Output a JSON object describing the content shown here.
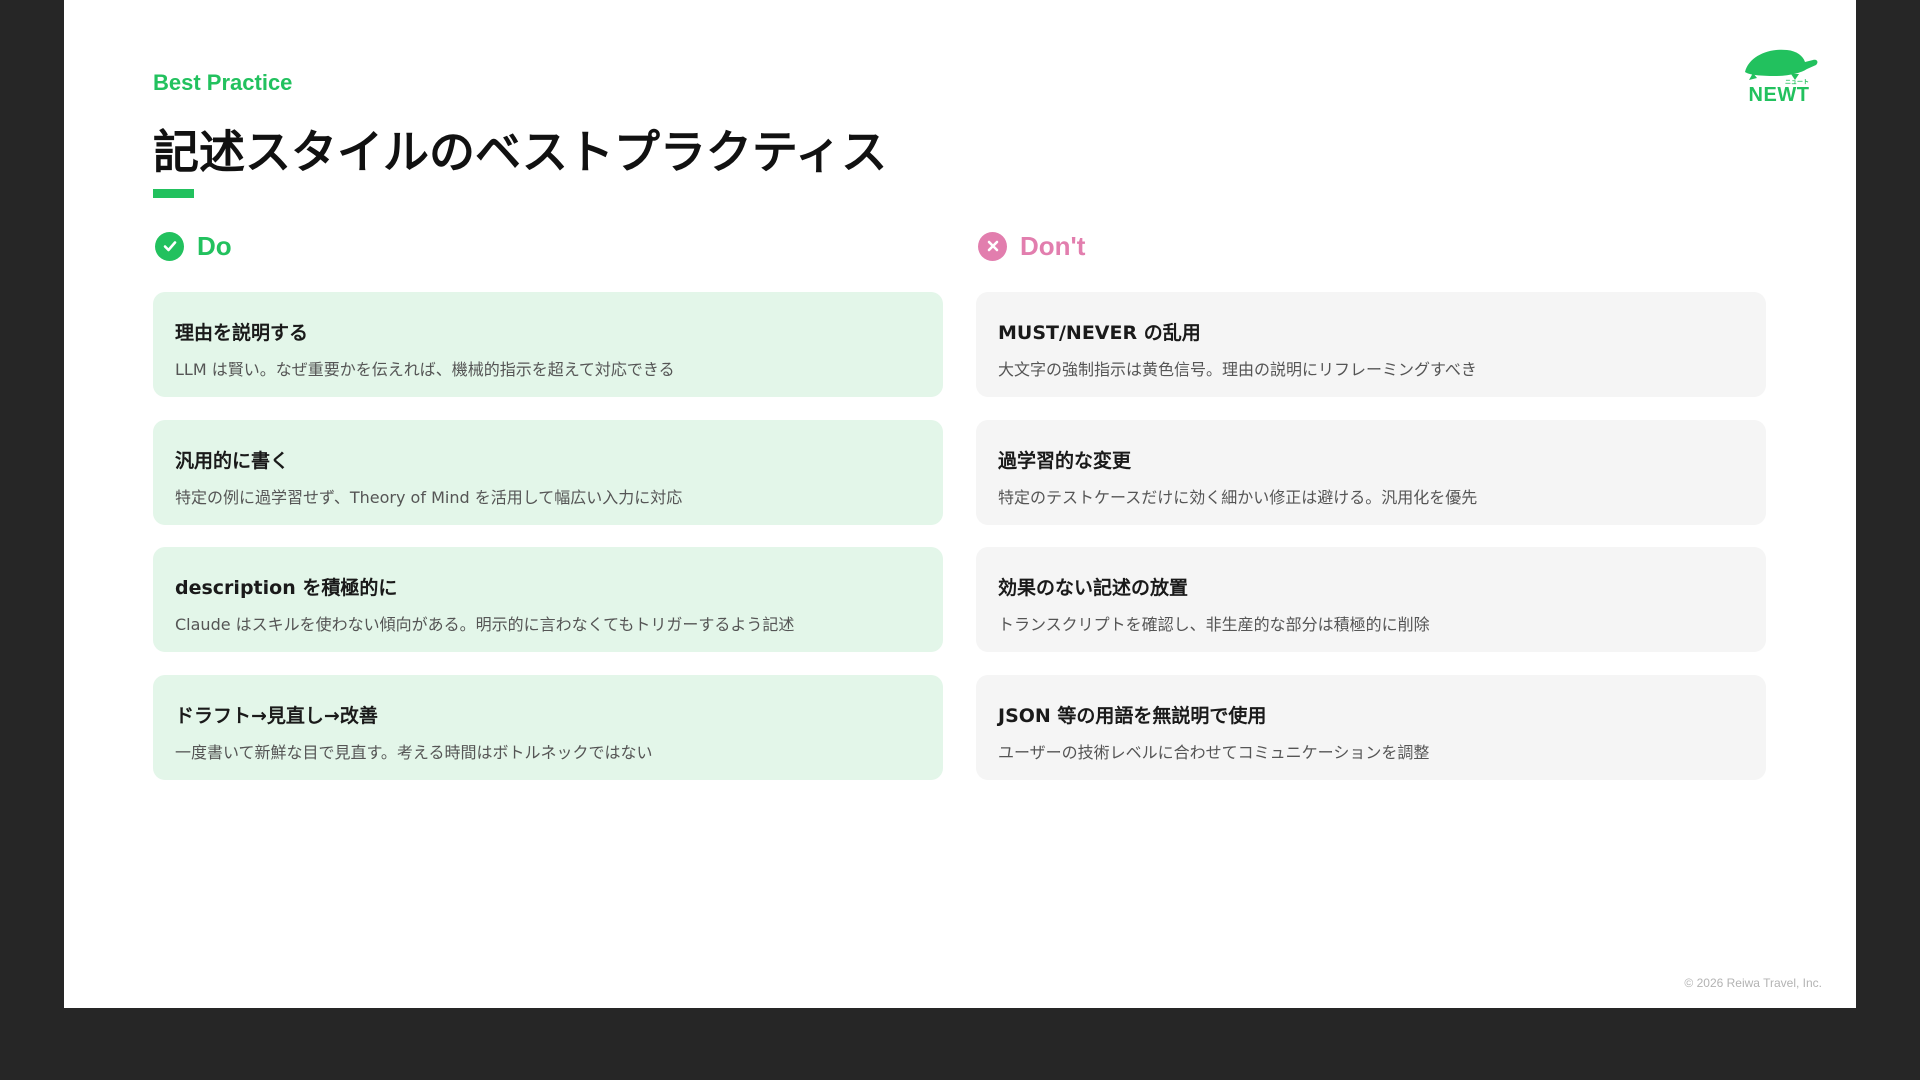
{
  "slide": {
    "eyebrow": "Best Practice",
    "title": "記述スタイルのベストプラクティス",
    "logo_text": "NEWT",
    "logo_small_text": "ニュート",
    "footer": "© 2026 Reiwa Travel, Inc."
  },
  "do": {
    "heading": "Do",
    "icon": "check-circle-icon",
    "items": [
      {
        "title": "理由を説明する",
        "desc": "LLM は賢い。なぜ重要かを伝えれば、機械的指示を超えて対応できる"
      },
      {
        "title": "汎用的に書く",
        "desc": "特定の例に過学習せず、Theory of Mind を活用して幅広い入力に対応"
      },
      {
        "title": "description を積極的に",
        "desc": "Claude はスキルを使わない傾向がある。明示的に言わなくてもトリガーするよう記述"
      },
      {
        "title": "ドラフト→見直し→改善",
        "desc": "一度書いて新鮮な目で見直す。考える時間はボトルネックではない"
      }
    ]
  },
  "dont": {
    "heading": "Don't",
    "icon": "x-circle-icon",
    "items": [
      {
        "title": "MUST/NEVER の乱用",
        "desc": "大文字の強制指示は黄色信号。理由の説明にリフレーミングすべき"
      },
      {
        "title": "過学習的な変更",
        "desc": "特定のテストケースだけに効く細かい修正は避ける。汎用化を優先"
      },
      {
        "title": "効果のない記述の放置",
        "desc": "トランスクリプトを確認し、非生産的な部分は積極的に削除"
      },
      {
        "title": "JSON 等の用語を無説明で使用",
        "desc": "ユーザーの技術レベルに合わせてコミュニケーションを調整"
      }
    ]
  },
  "colors": {
    "accent": "#22c15e",
    "do_card": "#e3f6e9",
    "dont_accent": "#e27eae",
    "dont_card": "#f5f5f5",
    "background": "#262626"
  }
}
